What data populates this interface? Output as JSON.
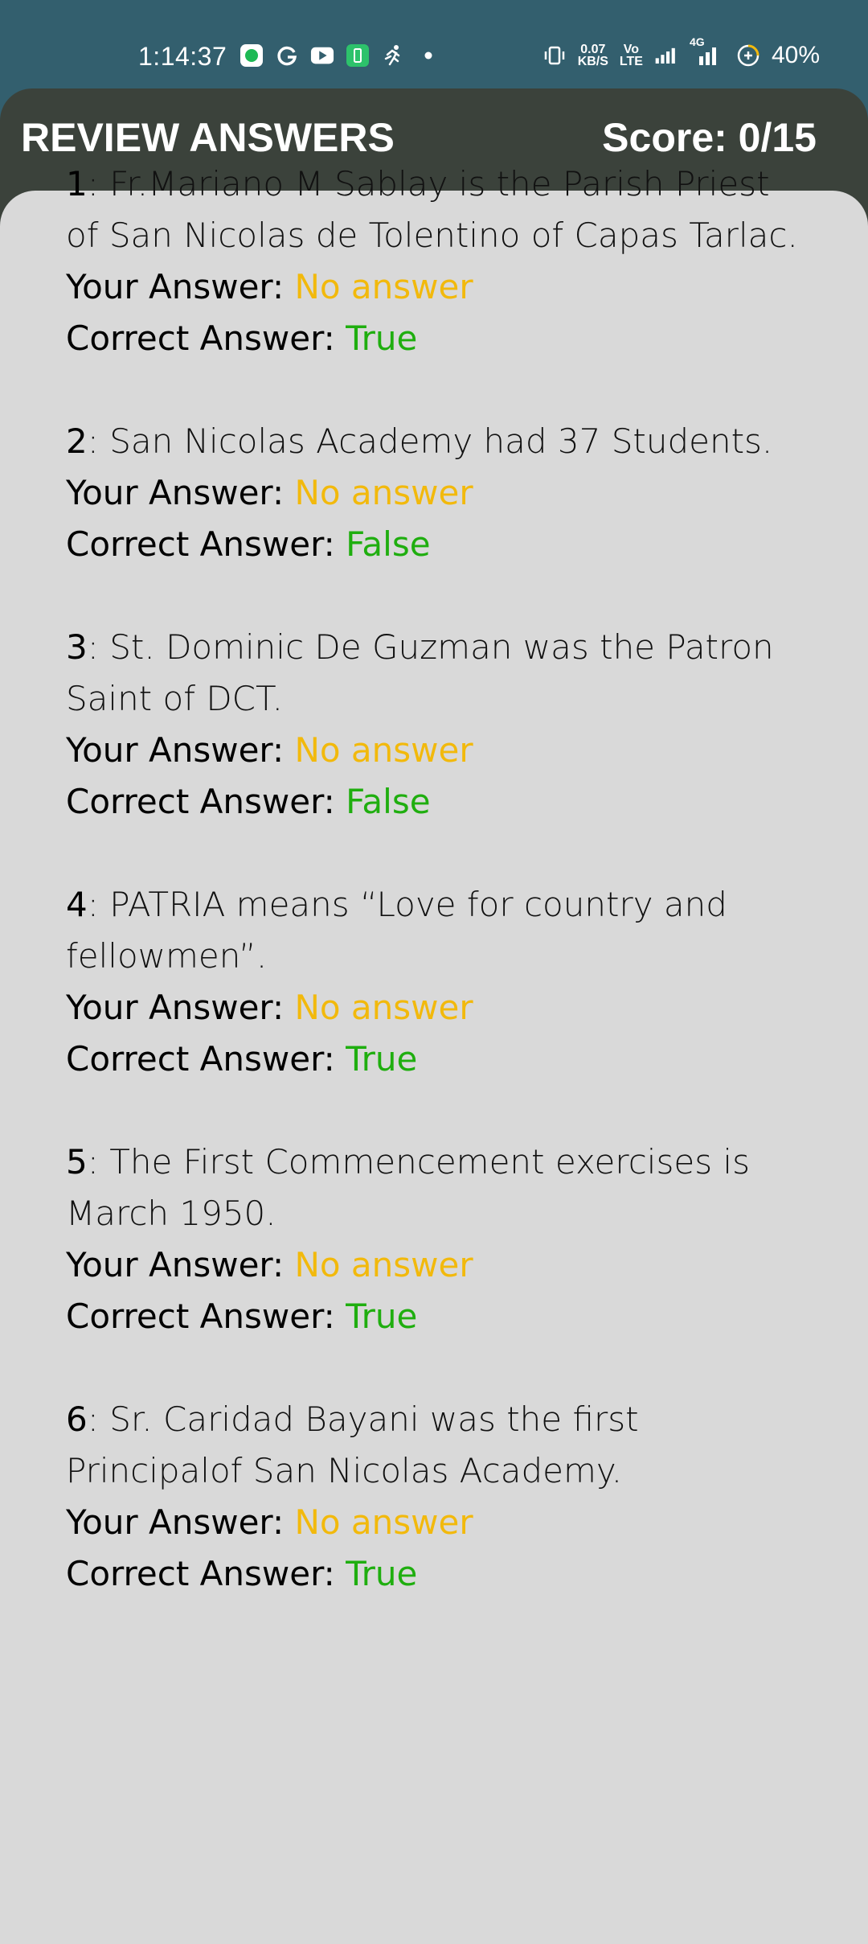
{
  "status_bar": {
    "time": "1:14:37",
    "net_speed_top": "0.07",
    "net_speed_bottom": "KB/S",
    "volte_top": "Vo",
    "volte_bottom": "LTE",
    "network": "4G",
    "battery": "40%",
    "icons": [
      "chat-icon",
      "g-icon",
      "youtube-icon",
      "battery-saver-icon",
      "running-icon",
      "dot-icon",
      "vibrate-icon",
      "signal-icon",
      "signal-4g-icon",
      "battery-icon"
    ]
  },
  "header": {
    "title": "REVIEW ANSWERS",
    "score": "Score: 0/15"
  },
  "labels": {
    "your_answer": "Your Answer: ",
    "correct_answer": "Correct Answer: "
  },
  "questions": [
    {
      "num": "1",
      "text": ": Fr.Mariano M Sablay is the Parish Priest of San Nicolas de Tolentino of Capas Tarlac.",
      "your_answer": "No answer",
      "correct_answer": "True"
    },
    {
      "num": "2",
      "text": ": San Nicolas Academy had 37 Students.",
      "your_answer": "No answer",
      "correct_answer": "False"
    },
    {
      "num": "3",
      "text": ": St. Dominic De Guzman was the Patron Saint of DCT.",
      "your_answer": "No answer",
      "correct_answer": "False"
    },
    {
      "num": "4",
      "text": ": PATRIA means “Love for country and fellowmen”.",
      "your_answer": "No answer",
      "correct_answer": "True"
    },
    {
      "num": "5",
      "text": ": The First Commencement exercises is March 1950.",
      "your_answer": "No answer",
      "correct_answer": "True"
    },
    {
      "num": "6",
      "text": ": Sr. Caridad Bayani was the first Principalof San Nicolas Academy.",
      "your_answer": "No answer",
      "correct_answer": "True"
    }
  ],
  "colors": {
    "status_bar": "#335f6e",
    "header": "#3b423b",
    "card": "#d9d9d9",
    "your_answer": "#f2b90c",
    "correct_answer": "#1fae0f"
  }
}
